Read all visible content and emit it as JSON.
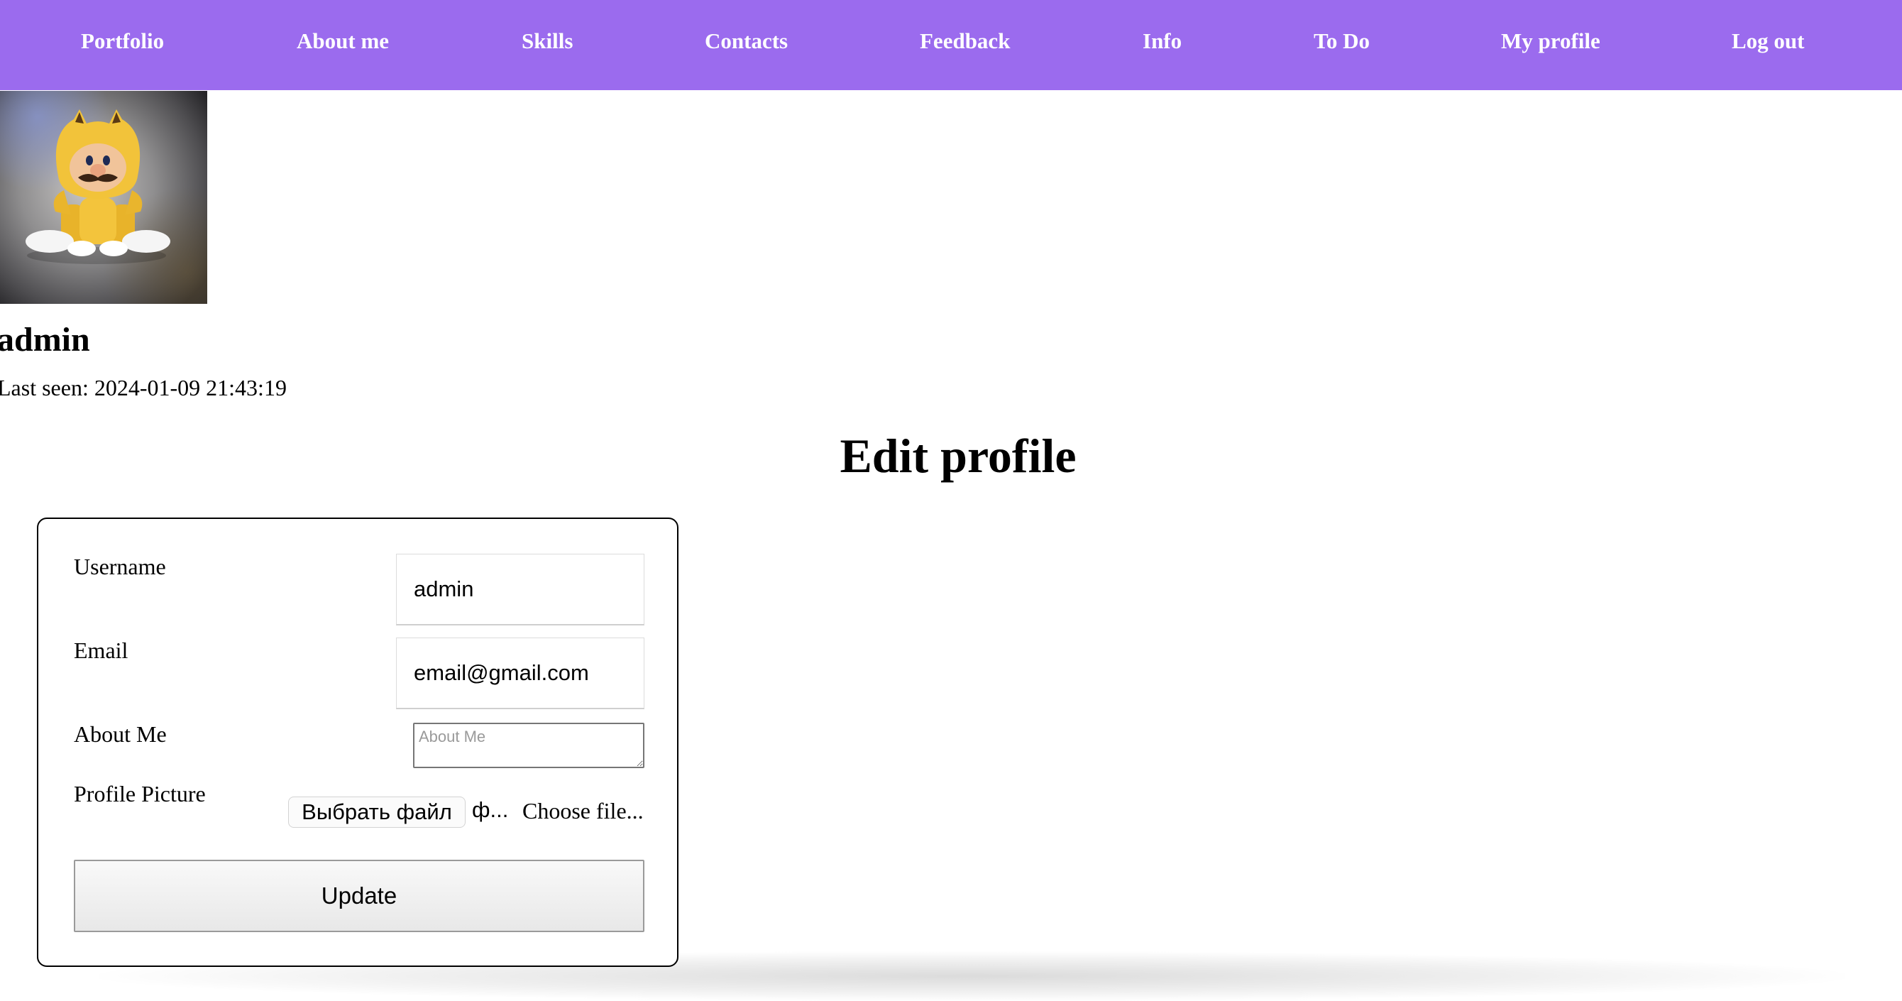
{
  "nav": {
    "items": [
      {
        "label": "Portfolio"
      },
      {
        "label": "About me"
      },
      {
        "label": "Skills"
      },
      {
        "label": "Contacts"
      },
      {
        "label": "Feedback"
      },
      {
        "label": "Info"
      },
      {
        "label": "To Do"
      },
      {
        "label": "My profile"
      },
      {
        "label": "Log out"
      }
    ],
    "background_color": "#9b6bee"
  },
  "profile": {
    "username": "admin",
    "last_seen": "Last seen: 2024-01-09 21:43:19",
    "avatar_description": "cat-suit-character-avatar"
  },
  "page_title": "Edit profile",
  "form": {
    "username_label": "Username",
    "username_value": "admin",
    "email_label": "Email",
    "email_value": "email@gmail.com",
    "about_label": "About Me",
    "about_placeholder": "About Me",
    "about_value": "",
    "picture_label": "Profile Picture",
    "file_button_label": "Выбрать файл",
    "file_name": "ф...",
    "file_hint": "Choose file...",
    "submit_label": "Update"
  }
}
